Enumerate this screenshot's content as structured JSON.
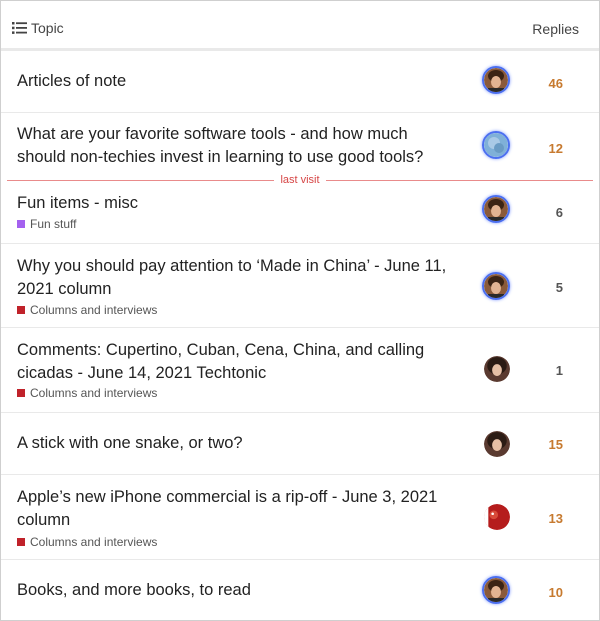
{
  "header": {
    "topic_label": "Topic",
    "replies_label": "Replies"
  },
  "last_visit_label": "last visit",
  "colors": {
    "hot_replies": "#c77a2f",
    "normal_replies": "#555555",
    "columns_category": "#c0222a",
    "fun_category": "#a461ef"
  },
  "topics": [
    {
      "title": "Articles of note",
      "category": "",
      "replies": "46",
      "hot": true,
      "avatar": "man-dark-hair"
    },
    {
      "title": "What are your favorite software tools - and how much should non-techies invest in learning to use good tools?",
      "category": "",
      "replies": "12",
      "hot": true,
      "avatar": "globe"
    },
    {
      "title": "Fun items - misc",
      "category": "Fun stuff",
      "replies": "6",
      "hot": false,
      "avatar": "man-dark-hair"
    },
    {
      "title": "Why you should pay attention to ‘Made in China’ - June 11, 2021 column",
      "category": "Columns and interviews",
      "replies": "5",
      "hot": false,
      "avatar": "man-dark-hair"
    },
    {
      "title": "Comments: Cupertino, Cuban, Cena, China, and calling cicadas - June 14, 2021 Techtonic",
      "category": "Columns and interviews",
      "replies": "1",
      "hot": false,
      "avatar": "woman-dark-hair"
    },
    {
      "title": "A stick with one snake, or two?",
      "category": "",
      "replies": "15",
      "hot": true,
      "avatar": "woman-dark-hair"
    },
    {
      "title": "Apple’s new iPhone commercial is a rip-off - June 3, 2021 column",
      "category": "Columns and interviews",
      "replies": "13",
      "hot": true,
      "avatar": "red-bird"
    },
    {
      "title": "Books, and more books, to read",
      "category": "",
      "replies": "10",
      "hot": true,
      "avatar": "man-dark-hair"
    }
  ]
}
